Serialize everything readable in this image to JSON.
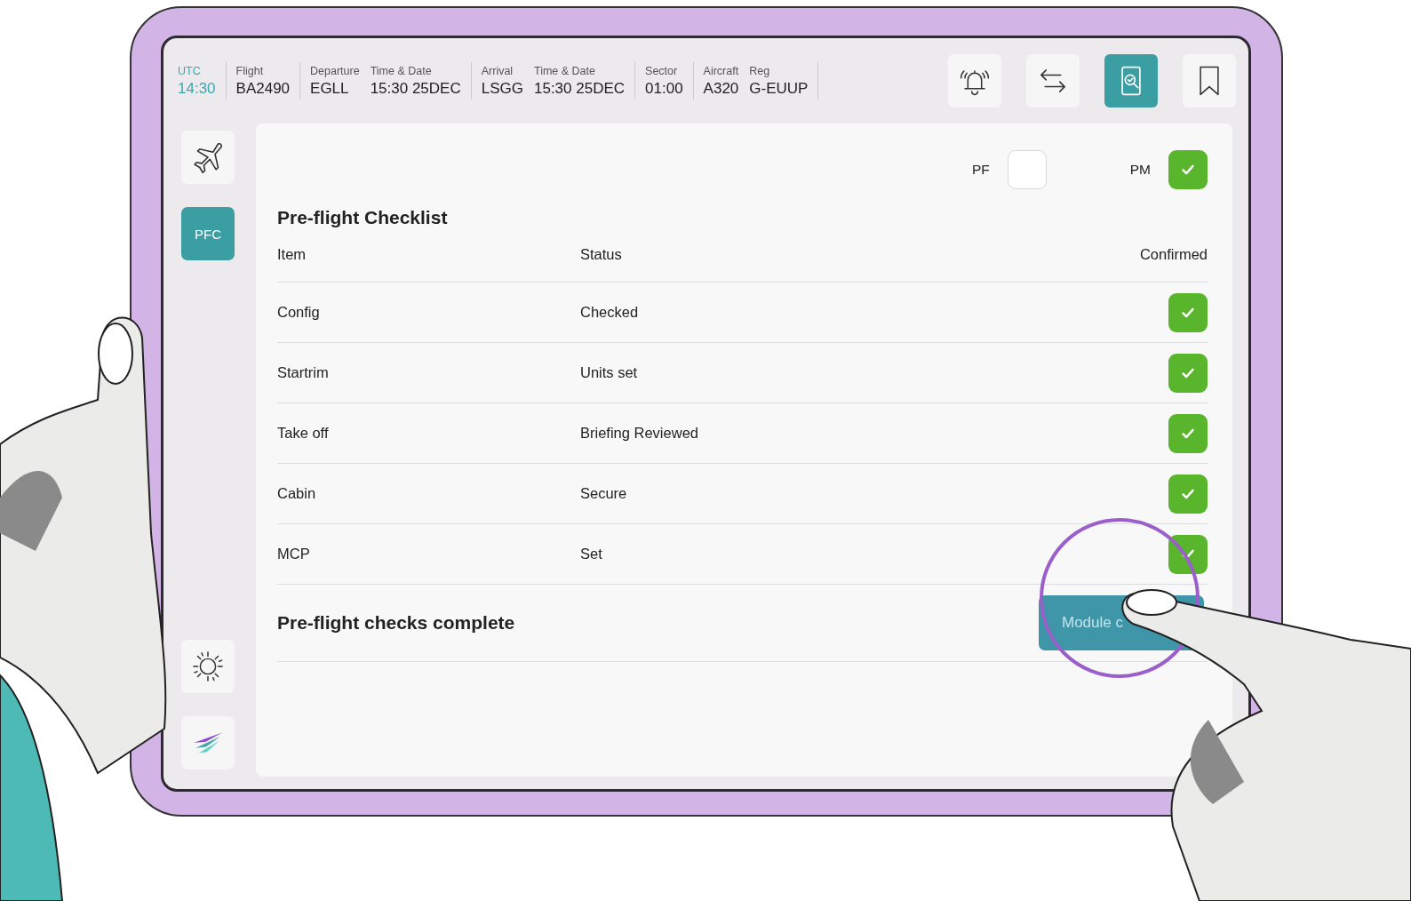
{
  "header": {
    "groups": [
      {
        "fields": [
          {
            "label": "UTC",
            "value": "14:30",
            "kind": "clock"
          }
        ]
      },
      {
        "fields": [
          {
            "label": "Flight",
            "value": "BA2490",
            "kind": "info"
          }
        ]
      },
      {
        "fields": [
          {
            "label": "Departure",
            "value": "EGLL",
            "kind": "info"
          },
          {
            "label": "Time & Date",
            "value": "15:30 25DEC",
            "kind": "info"
          }
        ]
      },
      {
        "fields": [
          {
            "label": "Arrival",
            "value": "LSGG",
            "kind": "info"
          },
          {
            "label": "Time & Date",
            "value": "15:30 25DEC",
            "kind": "info"
          }
        ]
      },
      {
        "fields": [
          {
            "label": "Sector",
            "value": "01:00",
            "kind": "info"
          }
        ]
      },
      {
        "fields": [
          {
            "label": "Aircraft",
            "value": "A320",
            "kind": "info"
          },
          {
            "label": "Reg",
            "value": "G-EUUP",
            "kind": "info"
          }
        ]
      }
    ],
    "tools": [
      {
        "kind": "bell",
        "selected": false
      },
      {
        "kind": "swap",
        "selected": false
      },
      {
        "kind": "doc-search",
        "selected": true
      },
      {
        "kind": "bookmark",
        "selected": false
      }
    ]
  },
  "sidebar": {
    "items": [
      {
        "kind": "plane",
        "selected": false
      },
      {
        "kind": "label",
        "label": "PFC",
        "selected": true
      },
      {
        "kind": "sun",
        "selected": false
      },
      {
        "kind": "logo",
        "selected": false
      }
    ]
  },
  "checklist": {
    "title": "Pre-flight Checklist",
    "pilots": [
      {
        "label": "PF",
        "checked": false
      },
      {
        "label": "PM",
        "checked": true
      }
    ],
    "columns": [
      "Item",
      "Status",
      "Confirmed"
    ],
    "rows": [
      {
        "item": "Config",
        "status": "Checked",
        "confirmed": true
      },
      {
        "item": "Startrim",
        "status": "Units set",
        "confirmed": true
      },
      {
        "item": "Take off",
        "status": "Briefing Reviewed",
        "confirmed": true
      },
      {
        "item": "Cabin",
        "status": "Secure",
        "confirmed": true
      },
      {
        "item": "MCP",
        "status": "Set",
        "confirmed": true
      }
    ],
    "footer": {
      "message": "Pre-flight checks complete",
      "button": "Module c"
    }
  }
}
